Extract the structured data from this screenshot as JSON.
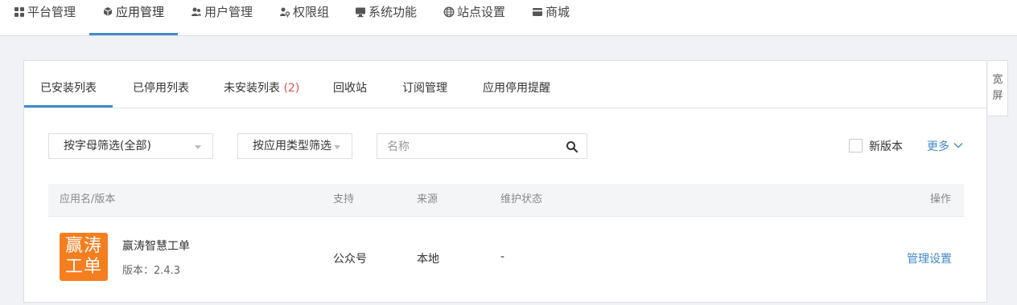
{
  "topnav": {
    "items": [
      {
        "label": "平台管理",
        "icon": "grid-icon"
      },
      {
        "label": "应用管理",
        "icon": "cubes-icon",
        "active": true
      },
      {
        "label": "用户管理",
        "icon": "users-icon"
      },
      {
        "label": "权限组",
        "icon": "user-key-icon"
      },
      {
        "label": "系统功能",
        "icon": "monitor-icon"
      },
      {
        "label": "站点设置",
        "icon": "globe-icon"
      },
      {
        "label": "商城",
        "icon": "card-icon"
      }
    ]
  },
  "side": {
    "wide_label": "宽屏"
  },
  "tabs": {
    "items": [
      {
        "label": "已安装列表"
      },
      {
        "label": "已停用列表"
      },
      {
        "label": "未安装列表 ",
        "count": "(2)"
      },
      {
        "label": "回收站"
      },
      {
        "label": "订阅管理"
      },
      {
        "label": "应用停用提醒"
      }
    ]
  },
  "filters": {
    "letter": "按字母筛选(全部)",
    "type": "按应用类型筛选",
    "search_placeholder": "名称",
    "new_version_label": "新版本",
    "more_label": "更多"
  },
  "table": {
    "headers": {
      "app": "应用名/版本",
      "support": "支持",
      "source": "来源",
      "status": "维护状态",
      "action": "操作"
    },
    "rows": [
      {
        "logo_text": "赢涛工单",
        "name": "赢涛智慧工单",
        "version": "版本：2.4.3",
        "support": "公众号",
        "source": "本地",
        "status": "-",
        "action": "管理设置"
      }
    ]
  },
  "colors": {
    "accent": "#428bca",
    "logo_bg": "#f57e1f",
    "count": "#d9534f"
  }
}
